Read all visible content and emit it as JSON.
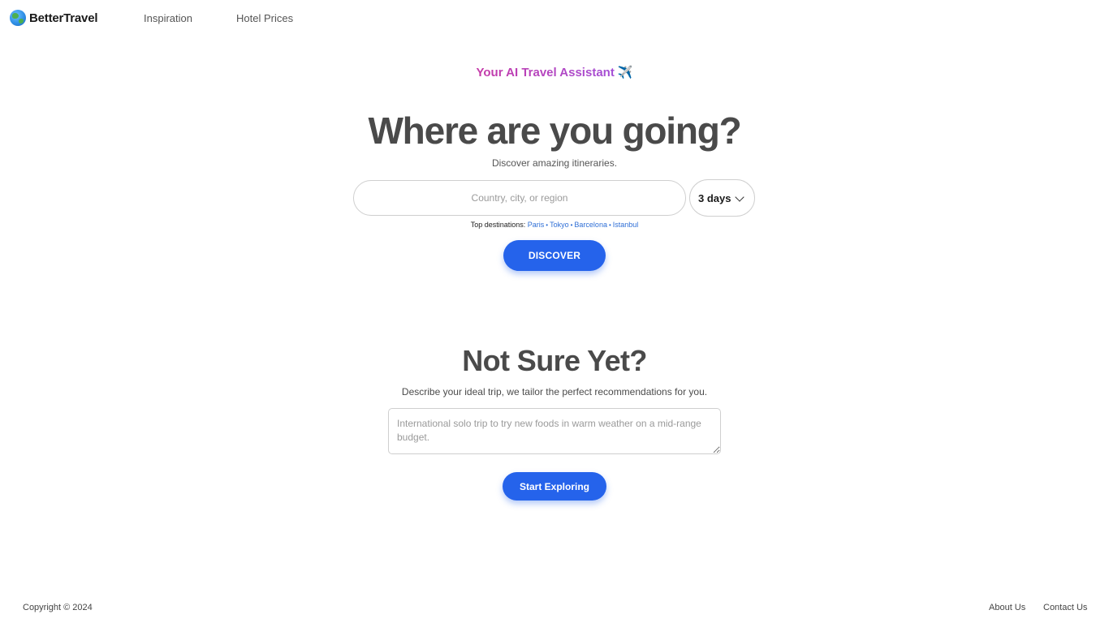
{
  "header": {
    "logo_text": "BetterTravel",
    "logo_icon": "globe-icon",
    "nav": {
      "inspiration": "Inspiration",
      "hotel_prices": "Hotel Prices"
    }
  },
  "hero": {
    "tagline": "Your AI Travel Assistant",
    "tagline_emoji": "✈️",
    "title": "Where are you going?",
    "subtitle": "Discover amazing itineraries.",
    "search": {
      "value": "",
      "placeholder": "Country, city, or region"
    },
    "duration": {
      "selected": "3 days"
    },
    "top_destinations": {
      "label": "Top destinations:",
      "items": [
        "Paris",
        "Tokyo",
        "Barcelona",
        "Istanbul"
      ],
      "separator": "•"
    },
    "discover_button": "DISCOVER"
  },
  "describe": {
    "title": "Not Sure Yet?",
    "subtitle": "Describe your ideal trip, we tailor the perfect recommendations for you.",
    "textarea": {
      "value": "",
      "placeholder": "International solo trip to try new foods in warm weather on a mid-range budget."
    },
    "explore_button": "Start Exploring"
  },
  "footer": {
    "copyright": "Copyright © 2024",
    "about": "About Us",
    "contact": "Contact Us"
  },
  "colors": {
    "primary_button": "#2563eb",
    "link": "#2f6fd6",
    "tagline_gradient_start": "#c53aa8",
    "tagline_gradient_end": "#a44fd6"
  }
}
